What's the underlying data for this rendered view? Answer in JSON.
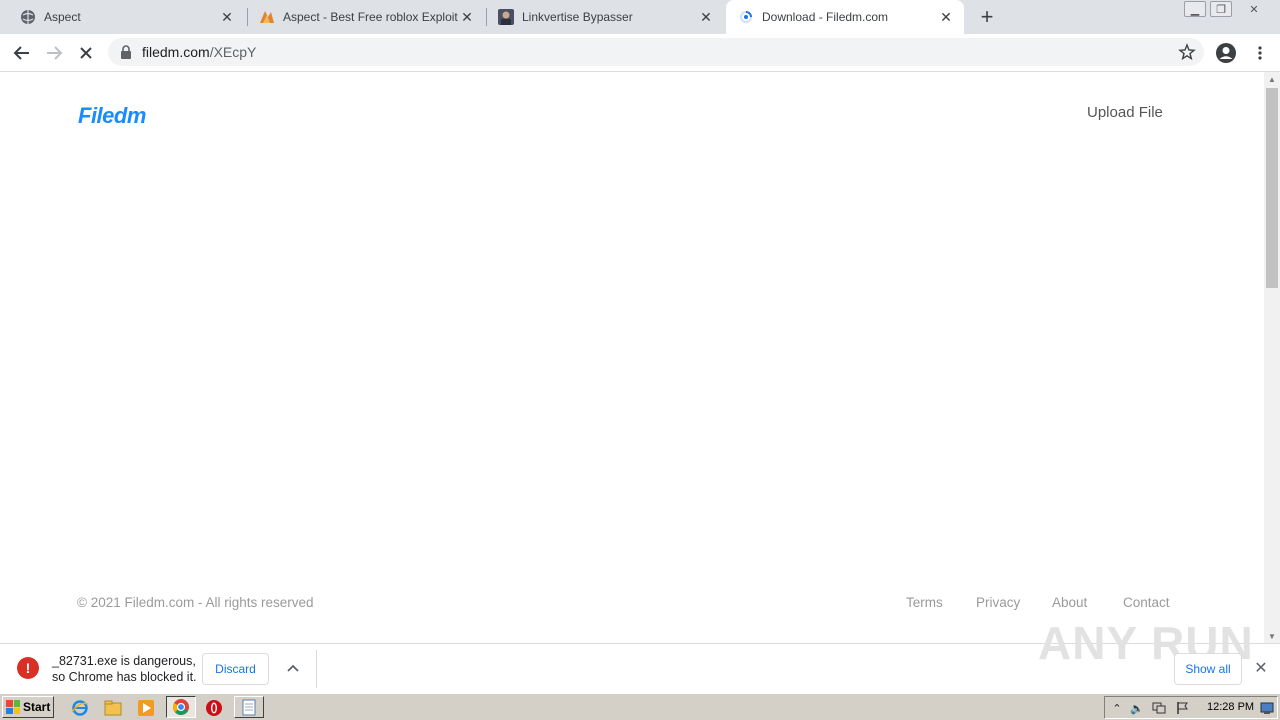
{
  "browser": {
    "tabs": [
      {
        "title": "Aspect",
        "active": false
      },
      {
        "title": "Aspect - Best Free roblox Exploit [No",
        "active": false
      },
      {
        "title": "Linkvertise Bypasser",
        "active": false
      },
      {
        "title": "Download - Filedm.com",
        "active": true
      }
    ],
    "url": {
      "domain": "filedm.com",
      "path": "/XEcpY"
    }
  },
  "page": {
    "logo": "Filedm",
    "upload_label": "Upload File",
    "footer": {
      "copyright": "© 2021 Filedm.com - All rights reserved",
      "links": [
        "Terms",
        "Privacy",
        "About",
        "Contact"
      ]
    }
  },
  "download_shelf": {
    "message_line1": "_82731.exe is dangerous,",
    "message_line2": "so Chrome has blocked it.",
    "discard_label": "Discard",
    "show_all_label": "Show all",
    "watermark": "ANY RUN"
  },
  "taskbar": {
    "start_label": "Start",
    "clock": "12:28 PM"
  },
  "colors": {
    "brand": "#1a8cff",
    "danger": "#d93025",
    "link": "#1a73e8"
  }
}
